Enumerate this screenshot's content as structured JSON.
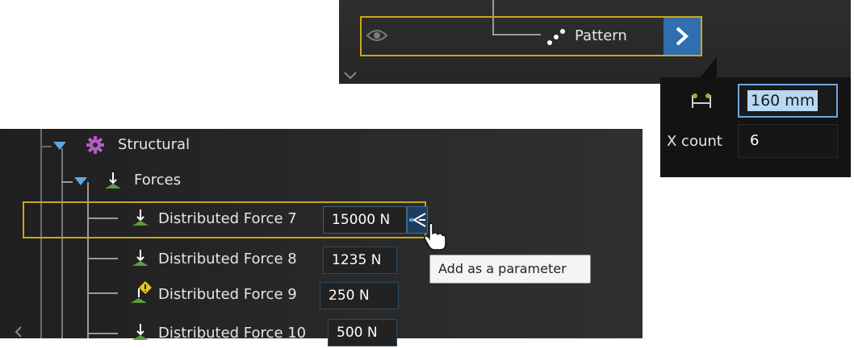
{
  "pattern_row": {
    "label": "Pattern",
    "icons": {
      "visibility": "eye-icon",
      "pattern": "pattern-dots-icon",
      "expand": "chevron-right-icon"
    }
  },
  "pattern_popup": {
    "spacing_value": "160 mm",
    "xcount_label": "X count",
    "xcount_value": "6",
    "icons": {
      "spacing": "spacing-icon"
    }
  },
  "tree": {
    "structural": {
      "label": "Structural",
      "icon": "gear-icon"
    },
    "forces": {
      "label": "Forces",
      "icon": "force-icon"
    },
    "items": [
      {
        "label": "Distributed Force 7",
        "value": "15000 N"
      },
      {
        "label": "Distributed Force 8",
        "value": "1235 N"
      },
      {
        "label": "Distributed Force 9",
        "value": "250 N"
      },
      {
        "label": "Distributed Force 10",
        "value": "500 N"
      }
    ],
    "tooltip": "Add as a parameter"
  },
  "colors": {
    "selection": "#c9a71c",
    "accent": "#2f6fb0",
    "gear": "#b05fc0",
    "force": "#5c9c3c"
  }
}
